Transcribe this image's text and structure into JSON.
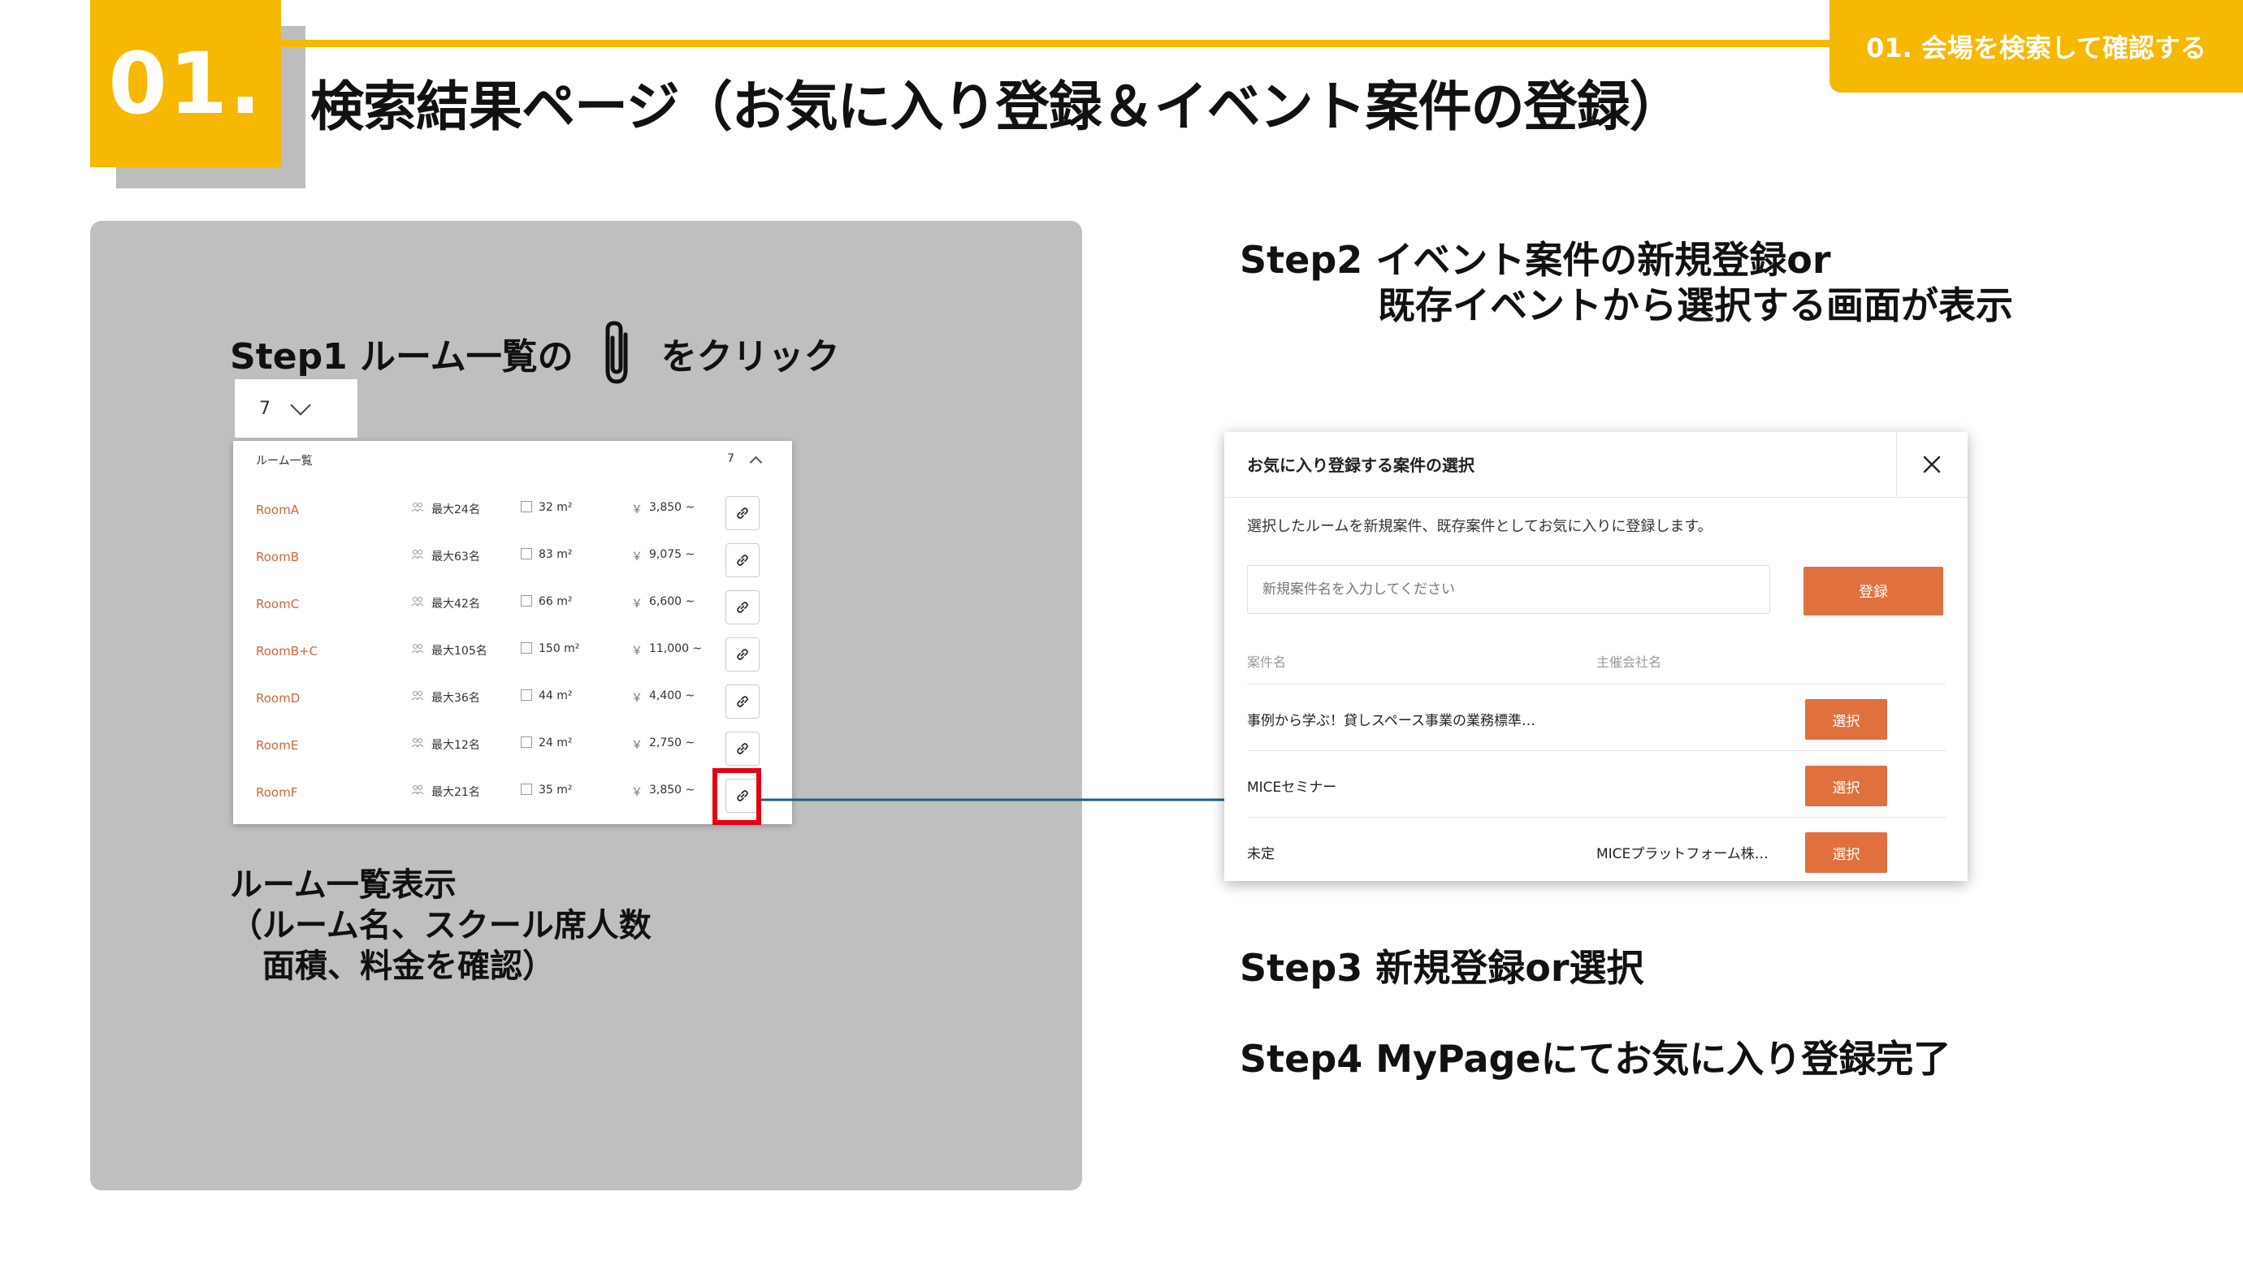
{
  "header": {
    "number": "01.",
    "title": "検索結果ページ（お気に入り登録＆イベント案件の登録）",
    "section_tab": "01. 会場を検索して確認する"
  },
  "left": {
    "step1_before": "Step1 ルーム一覧の",
    "step1_after": "をクリック",
    "count_select": "7",
    "room_list": {
      "title": "ルーム一覧",
      "count": "7",
      "rooms": [
        {
          "name": "RoomA",
          "capacity": "最大24名",
          "area": "32 m²",
          "price": "3,850 ~"
        },
        {
          "name": "RoomB",
          "capacity": "最大63名",
          "area": "83 m²",
          "price": "9,075 ~"
        },
        {
          "name": "RoomC",
          "capacity": "最大42名",
          "area": "66 m²",
          "price": "6,600 ~"
        },
        {
          "name": "RoomB+C",
          "capacity": "最大105名",
          "area": "150 m²",
          "price": "11,000 ~"
        },
        {
          "name": "RoomD",
          "capacity": "最大36名",
          "area": "44 m²",
          "price": "4,400 ~"
        },
        {
          "name": "RoomE",
          "capacity": "最大12名",
          "area": "24 m²",
          "price": "2,750 ~"
        },
        {
          "name": "RoomF",
          "capacity": "最大21名",
          "area": "35 m²",
          "price": "3,850 ~"
        }
      ],
      "yen": "￥"
    },
    "caption": [
      "ルーム一覧表示",
      "（ルーム名、スクール席人数",
      "面積、料金を確認）"
    ]
  },
  "right": {
    "step2": [
      "Step2   イベント案件の新規登録or",
      "既存イベントから選択する画面が表示"
    ],
    "step3": "Step3   新規登録or選択",
    "step4": "Step4   MyPageにてお気に入り登録完了"
  },
  "modal": {
    "title": "お気に入り登録する案件の選択",
    "description": "選択したルームを新規案件、既存案件としてお気に入りに登録します。",
    "input_placeholder": "新規案件名を入力してください",
    "register_label": "登録",
    "col_name": "案件名",
    "col_org": "主催会社名",
    "rows": [
      {
        "name": "事例から学ぶ！貸しスペース事業の業務標準…",
        "org": "",
        "button": "選択"
      },
      {
        "name": "MICEセミナー",
        "org": "",
        "button": "選択"
      },
      {
        "name": "未定",
        "org": "MICEプラットフォーム株…",
        "button": "選択"
      }
    ]
  },
  "colors": {
    "accent": "#f6b800",
    "panel": "#bfbfbf",
    "orange_button": "#e0703e",
    "room_name": "#d2643c",
    "highlight": "#e60012",
    "connector": "#1f5f7f"
  },
  "icons": [
    "paperclip-icon",
    "link-icon",
    "close-icon",
    "people-icon",
    "area-icon",
    "chevron-down-icon",
    "chevron-up-icon"
  ]
}
